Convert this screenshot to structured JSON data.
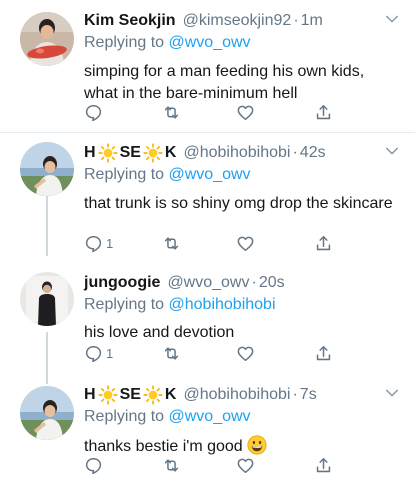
{
  "tweets": [
    {
      "name": "Kim Seokjin",
      "handle": "@kimseokjin92",
      "time": "1m",
      "replying_prefix": "Replying to ",
      "replying_to": "@wvo_owv",
      "text": "simping for a man feeding his own kids, what in the bare-minimum hell",
      "reply_count": "",
      "avatar": "man-holding-fish"
    },
    {
      "name_parts": [
        "H",
        "SE",
        "K"
      ],
      "handle": "@hobihobihobi",
      "time": "42s",
      "replying_prefix": "Replying to ",
      "replying_to": "@wvo_owv",
      "text": "that trunk is so shiny omg drop the skincare",
      "reply_count": "1",
      "avatar": "person-coastal"
    },
    {
      "name": "jungoogie",
      "handle": "@wvo_owv",
      "time": "20s",
      "replying_prefix": "Replying to ",
      "replying_to": "@hobihobihobi",
      "text": "his love and devotion",
      "reply_count": "1",
      "avatar": "person-standing-dark"
    },
    {
      "name_parts": [
        "H",
        "SE",
        "K"
      ],
      "handle": "@hobihobihobi",
      "time": "7s",
      "replying_prefix": "Replying to ",
      "replying_to": "@wvo_owv",
      "text": "thanks bestie i'm good",
      "reply_count": "",
      "avatar": "person-coastal"
    }
  ],
  "icons": {
    "reply": "reply-icon",
    "retweet": "retweet-icon",
    "like": "heart-icon",
    "share": "share-icon",
    "menu": "chevron-down-icon",
    "name_emoji": "sun-icon",
    "text_emoji": "grinning-face-emoji"
  },
  "colors": {
    "text": "#14171a",
    "secondary": "#657786",
    "link": "#1da1f2",
    "separator": "#e6ecf0"
  }
}
